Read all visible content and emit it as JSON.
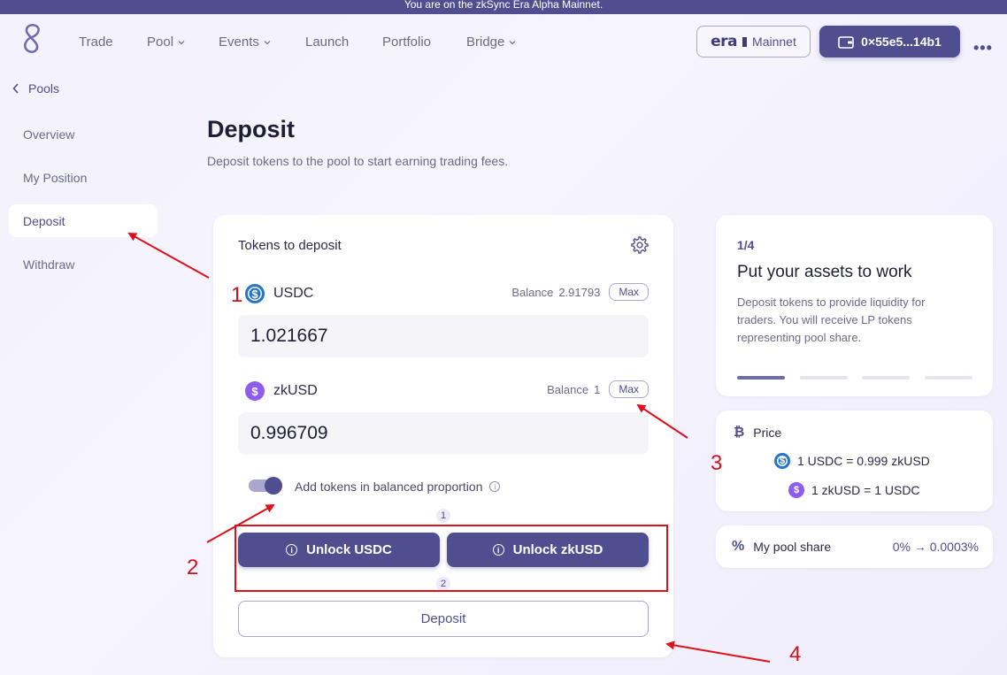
{
  "banner": {
    "text": "You are on the zkSync Era Alpha Mainnet."
  },
  "nav": {
    "items": [
      {
        "label": "Trade",
        "has_dropdown": false
      },
      {
        "label": "Pool",
        "has_dropdown": true
      },
      {
        "label": "Events",
        "has_dropdown": true
      },
      {
        "label": "Launch",
        "has_dropdown": false
      },
      {
        "label": "Portfolio",
        "has_dropdown": false
      },
      {
        "label": "Bridge",
        "has_dropdown": true
      }
    ],
    "network_logo": "era",
    "network_label": "Mainnet",
    "wallet_address": "0×55e5...14b1"
  },
  "sidebar": {
    "back_label": "Pools",
    "items": [
      {
        "label": "Overview",
        "active": false
      },
      {
        "label": "My Position",
        "active": false
      },
      {
        "label": "Deposit",
        "active": true
      },
      {
        "label": "Withdraw",
        "active": false
      }
    ]
  },
  "page": {
    "title": "Deposit",
    "subtitle": "Deposit tokens to the pool to start earning trading fees."
  },
  "deposit_card": {
    "title": "Tokens to deposit",
    "tokens": [
      {
        "symbol": "USDC",
        "icon": "usdc-icon",
        "balance_label": "Balance",
        "balance": "2.91793",
        "max_label": "Max",
        "amount": "1.021667"
      },
      {
        "symbol": "zkUSD",
        "icon": "zkusd-icon",
        "balance_label": "Balance",
        "balance": "1",
        "max_label": "Max",
        "amount": "0.996709"
      }
    ],
    "balanced_toggle_label": "Add tokens in balanced proportion",
    "balanced_toggle_on": true,
    "step_1": "1",
    "step_2": "2",
    "unlock_usdc_label": "Unlock USDC",
    "unlock_zkusd_label": "Unlock zkUSD",
    "deposit_label": "Deposit"
  },
  "info_card": {
    "step": "1/4",
    "title": "Put your assets to work",
    "body": "Deposit tokens to provide liquidity for traders. You will receive LP tokens representing pool share.",
    "progress_steps": 4,
    "progress_active": 1
  },
  "price_card": {
    "title": "Price",
    "line1": "1 USDC = 0.999 zkUSD",
    "line2": "1 zkUSD = 1 USDC"
  },
  "share_card": {
    "label": "My pool share",
    "value": "0% → 0.0003%"
  },
  "annotations": {
    "a1": "1",
    "a2": "2",
    "a3": "3",
    "a4": "4"
  },
  "colors": {
    "accent": "#4f4e8f",
    "annotation": "#d0101b",
    "usdc": "#2775ca",
    "zkusd": "#8d5df0"
  }
}
